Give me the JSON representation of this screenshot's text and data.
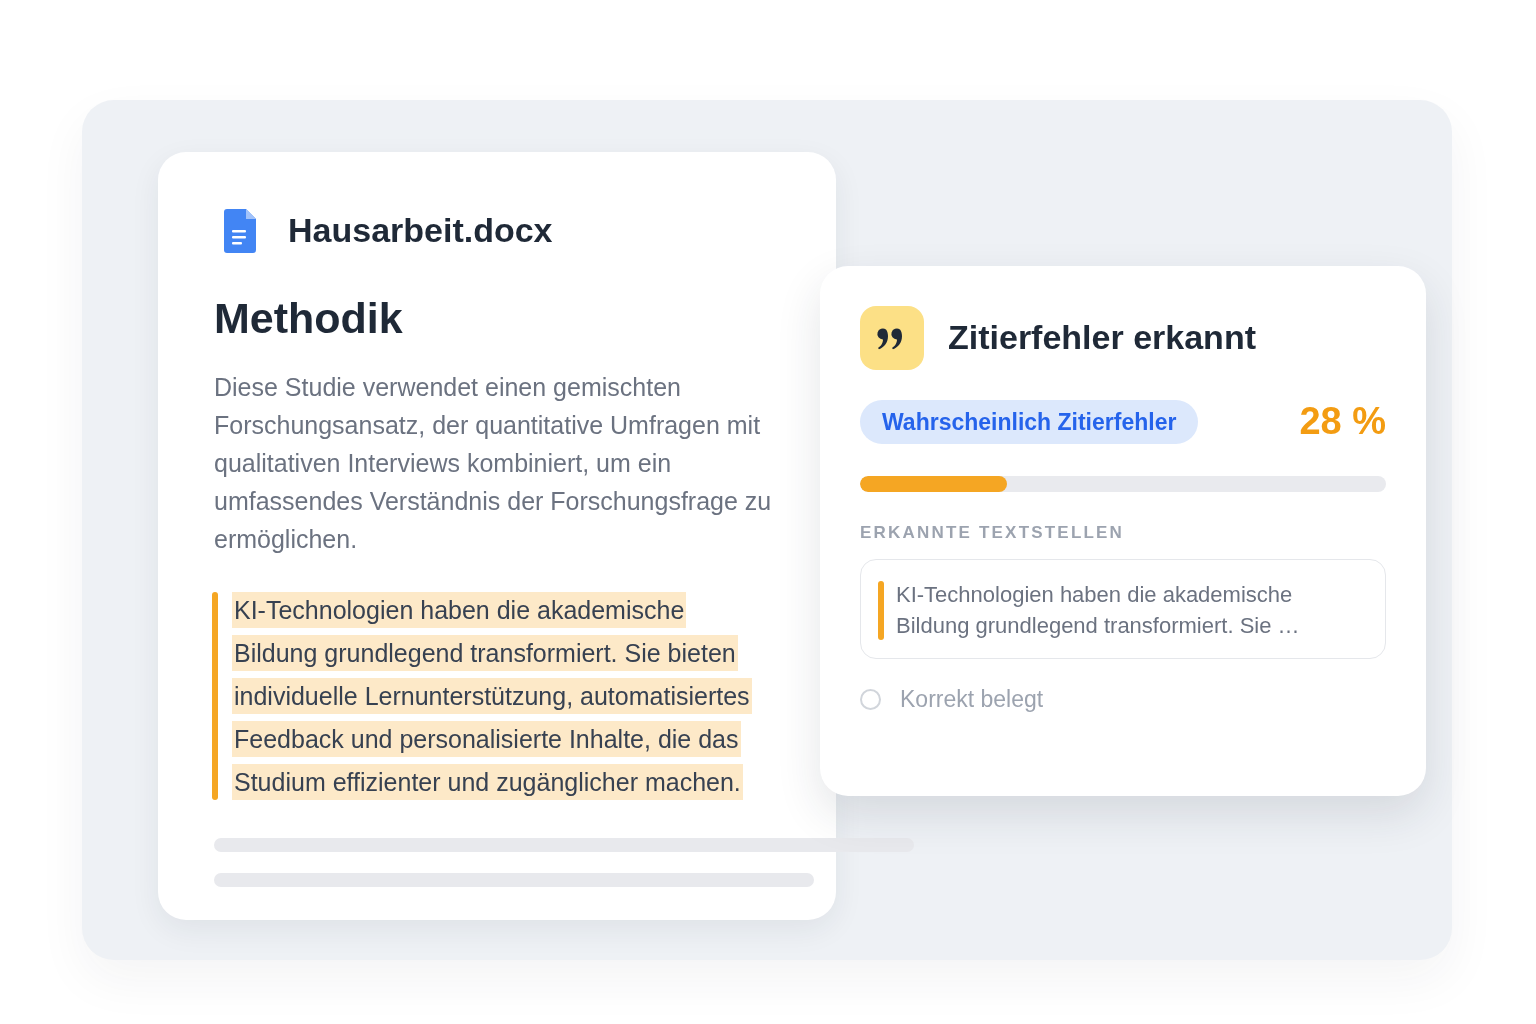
{
  "document": {
    "file_name": "Hausarbeit.docx",
    "heading": "Methodik",
    "paragraph": "Diese Studie verwendet einen gemischten Forschungsansatz, der quantitative Umfragen mit qualitativen Interviews kombiniert, um ein umfassendes Verständnis der Forschungsfrage zu ermöglichen.",
    "passage": {
      "lines": [
        "KI-Technologien haben die akademische",
        "Bildung grundlegend transformiert. Sie bieten",
        "individuelle Lernunterstützung, automatisiertes",
        "Feedback und personalisierte Inhalte, die das",
        "Studium effizienter und zugänglicher machen."
      ],
      "flagged": true
    }
  },
  "result": {
    "title": "Zitierfehler erkannt",
    "verdict": "Wahrscheinlich Zitierfehler",
    "score": "28 %",
    "level": 0.28,
    "section_label": "ERKANNTE TEXTSTELLEN",
    "excerpt": {
      "text": "KI-Technologien haben die akademische Bildung grundlegend transformiert. Sie …",
      "flagged": true
    },
    "options": [
      {
        "label": "Korrekt belegt",
        "selected": false
      }
    ]
  }
}
